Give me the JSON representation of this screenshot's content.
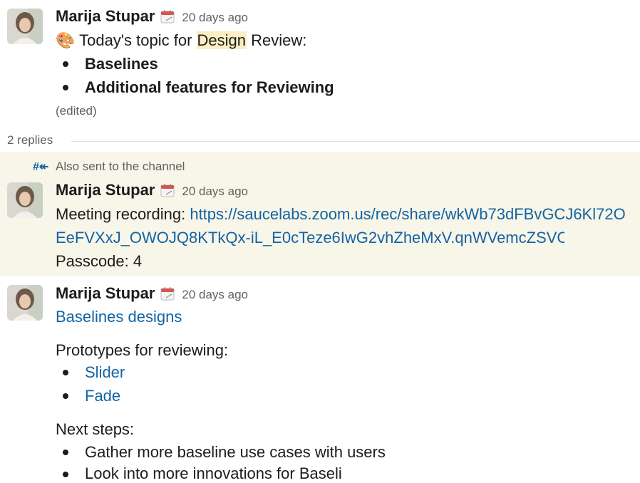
{
  "message1": {
    "author": "Marija Stupar",
    "time": "20 days ago",
    "emoji": "🎨",
    "line_prefix": "Today's topic for ",
    "line_highlight": "Design",
    "line_suffix": " Review:",
    "bullets": [
      "Baselines",
      "Additional features for Reviewing"
    ],
    "edited": "(edited)"
  },
  "thread": {
    "replies": "2 replies"
  },
  "message2": {
    "also_sent": "Also sent to the channel",
    "author": "Marija Stupar",
    "time": "20 days ago",
    "recording_label": "Meeting recording: ",
    "recording_link_1": "https://saucelabs.zoom.us/rec/share/wkWb73dFBvGCJ6Kl72O",
    "recording_link_2": "EeFVXxJ_OWOJQ8KTkQx-iL_E0cTeze6IwG2vhZheMxV.qnWVemcZSVC",
    "passcode": "Passcode: 4"
  },
  "message3": {
    "author": "Marija Stupar",
    "time": "20 days ago",
    "designs_link": "Baselines designs",
    "prototypes_label": "Prototypes for reviewing:",
    "prototype_links": [
      "Slider",
      "Fade"
    ],
    "next_steps_label": "Next steps:",
    "next_steps": [
      "Gather more baseline use cases with users",
      "Look into more innovations for Baseli"
    ]
  },
  "colors": {
    "link": "#1264a3",
    "highlight": "#fbeec2",
    "band": "#f8f5e9",
    "text": "#1d1c1d",
    "muted": "#616061"
  }
}
